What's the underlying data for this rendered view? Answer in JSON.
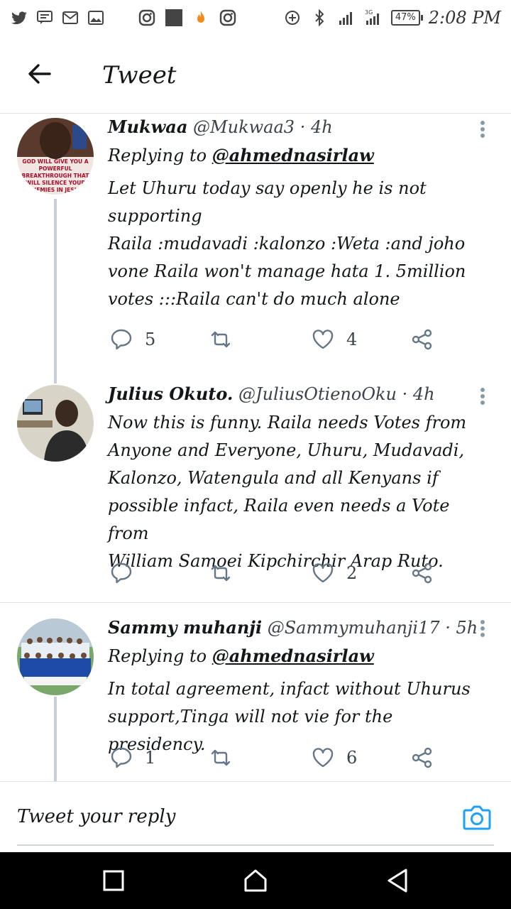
{
  "status_bar": {
    "time": "2:08 PM",
    "battery": "47%",
    "network": "3G",
    "icons": [
      "twitter-icon",
      "message-icon",
      "gmail-icon",
      "gallery-icon",
      "instagram-icon",
      "app-icon",
      "fire-icon",
      "instagram-icon",
      "data-saver-icon",
      "bluetooth-icon",
      "signal-icon",
      "signal-3g-icon",
      "battery-icon"
    ]
  },
  "header": {
    "title": "Tweet",
    "back_icon": "arrow-left-icon"
  },
  "tweets": [
    {
      "name": "Mukwaa",
      "handle": "@Mukwaa3",
      "time": "· 4h",
      "reply_prefix": "Replying to",
      "reply_handle": "@ahmednasirlaw",
      "body": "Let Uhuru today say openly he is not\nsupporting\nRaila :mudavadi :kalonzo :Weta :and joho\nvone Raila won't manage hata 1. 5million\nvotes :::Raila can't do much alone",
      "avatar_text": [
        "GOD WILL GIVE YOU A",
        "POWERFUL",
        "BREAKTHROUGH THAT",
        "WILL SILENCE YOUR",
        "ENEMIES IN JESUS"
      ],
      "replies": "5",
      "retweets": "",
      "likes": "4"
    },
    {
      "name": "Julius Okuto.",
      "handle": "@JuliusOtienoOku",
      "time": "· 4h",
      "body": "Now this is funny. Raila needs Votes from\nAnyone and Everyone, Uhuru, Mudavadi,\nKalonzo, Watengula and all Kenyans if\npossible infact, Raila even needs a Vote from\nWilliam Samoei Kipchirchir Arap Ruto.",
      "replies": "",
      "retweets": "",
      "likes": "2"
    },
    {
      "name": "Sammy muhanji",
      "handle": "@Sammymuhanji17",
      "time": "· 5h",
      "reply_prefix": "Replying to",
      "reply_handle": "@ahmednasirlaw",
      "body": "In total agreement, infact without Uhurus\nsupport,Tinga will not vie for the presidency.",
      "replies": "1",
      "retweets": "",
      "likes": "6"
    }
  ],
  "reply_bar": {
    "placeholder": "Tweet your reply",
    "camera_icon": "camera-icon"
  },
  "nav_bar": {
    "buttons": [
      "recents-square-icon",
      "home-icon",
      "back-triangle-icon"
    ]
  },
  "colors": {
    "accent": "#1da1f2",
    "icon_gray": "#657786",
    "divider": "#dfe3e6"
  }
}
